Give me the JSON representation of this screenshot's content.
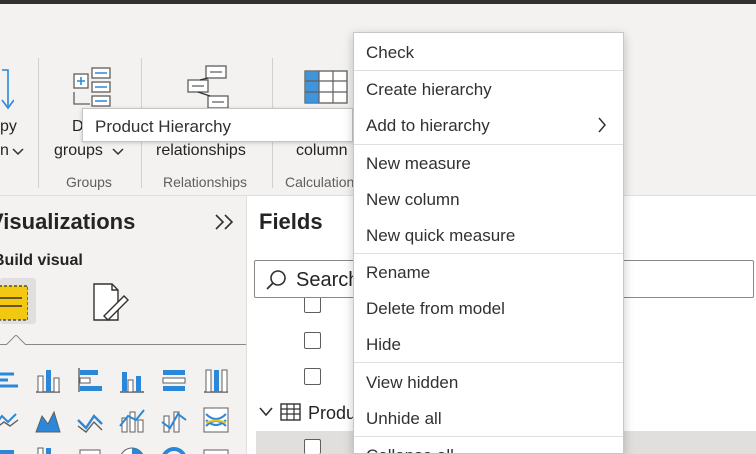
{
  "ribbon": {
    "labels": {
      "copy_fragment": "py",
      "copy_fragment2": "n",
      "new_group_top": "D",
      "new_group_bottom": "groups",
      "manage_rel": "relationships",
      "new_column": "column"
    },
    "group_labels": {
      "groups": "Groups",
      "relationships": "Relationships",
      "calculations": "Calculation"
    }
  },
  "tooltip": {
    "text": "Product Hierarchy"
  },
  "visualizations": {
    "title": "Visualizations",
    "build_visual": "Build visual"
  },
  "fields": {
    "title": "Fields",
    "search_placeholder": "Search",
    "table_name": "Produ"
  },
  "context_menu": {
    "items": [
      {
        "label": "Check"
      },
      {
        "label": "Create hierarchy"
      },
      {
        "label": "Add to hierarchy",
        "has_submenu": true
      },
      {
        "label": "New measure"
      },
      {
        "label": "New column"
      },
      {
        "label": "New quick measure"
      },
      {
        "label": "Rename"
      },
      {
        "label": "Delete from model"
      },
      {
        "label": "Hide"
      },
      {
        "label": "View hidden"
      },
      {
        "label": "Unhide all"
      },
      {
        "label": "Collapse all"
      }
    ]
  },
  "colors": {
    "accent_blue": "#2b88d8",
    "highlight_yellow": "#f2c811",
    "selection_gray": "#e1dfdd"
  }
}
